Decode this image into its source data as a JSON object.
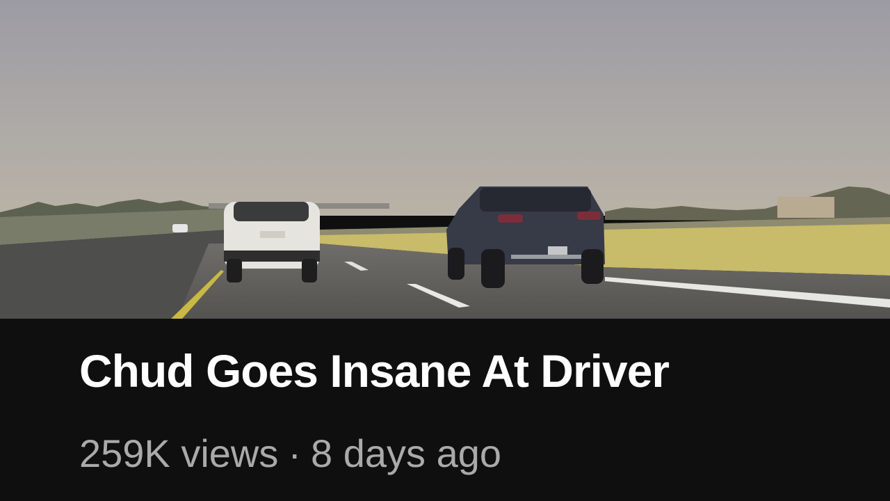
{
  "video": {
    "title": "Chud Goes Insane At Driver",
    "views": "259K views",
    "separator": "·",
    "age": "8 days ago"
  },
  "colors": {
    "background": "#0f0f0f",
    "title": "#ffffff",
    "meta": "#aaaaaa"
  }
}
